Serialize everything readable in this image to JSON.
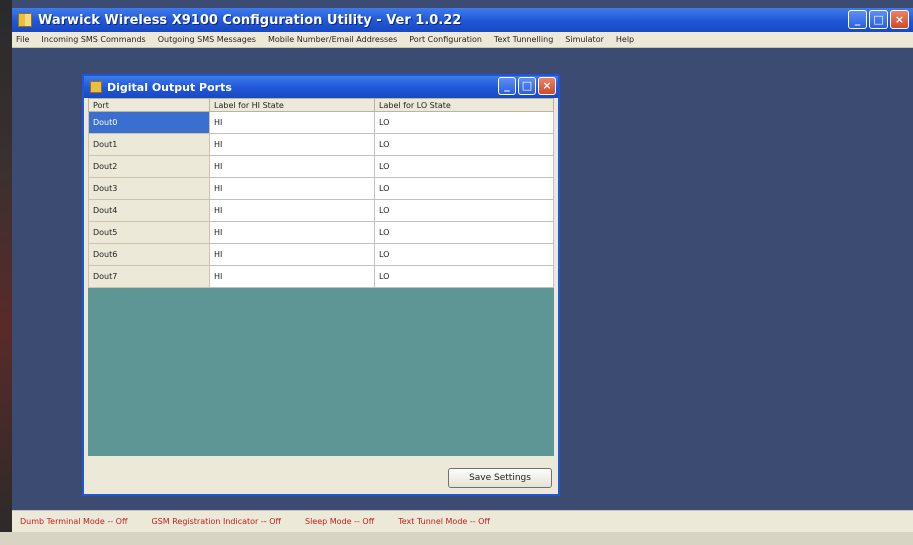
{
  "app": {
    "title": "Warwick Wireless X9100 Configuration Utility - Ver 1.0.22",
    "window_buttons": {
      "minimize": "_",
      "maximize": "□",
      "close": "×"
    }
  },
  "menu": {
    "items": [
      "File",
      "Incoming SMS Commands",
      "Outgoing SMS Messages",
      "Mobile Number/Email Addresses",
      "Port Configuration",
      "Text Tunnelling",
      "Simulator",
      "Help"
    ]
  },
  "child_window": {
    "title": "Digital Output Ports",
    "columns": [
      "Port",
      "Label for HI State",
      "Label for LO State"
    ],
    "rows": [
      {
        "port": "Dout0",
        "hi": "HI",
        "lo": "LO",
        "selected": true
      },
      {
        "port": "Dout1",
        "hi": "HI",
        "lo": "LO"
      },
      {
        "port": "Dout2",
        "hi": "HI",
        "lo": "LO"
      },
      {
        "port": "Dout3",
        "hi": "HI",
        "lo": "LO"
      },
      {
        "port": "Dout4",
        "hi": "HI",
        "lo": "LO"
      },
      {
        "port": "Dout5",
        "hi": "HI",
        "lo": "LO"
      },
      {
        "port": "Dout6",
        "hi": "HI",
        "lo": "LO"
      },
      {
        "port": "Dout7",
        "hi": "HI",
        "lo": "LO"
      }
    ],
    "save_label": "Save Settings"
  },
  "status": {
    "items": [
      "Dumb Terminal Mode -- Off",
      "GSM Registration Indicator -- Off",
      "Sleep Mode -- Off",
      "Text Tunnel Mode -- Off"
    ]
  },
  "colors": {
    "titlebar": "#1f56d8",
    "grid_background": "#5e9595",
    "status_text": "#c02020",
    "desktop": "#3c4b72"
  },
  "icons": [
    "app-icon",
    "minimize-icon",
    "maximize-icon",
    "close-icon"
  ]
}
